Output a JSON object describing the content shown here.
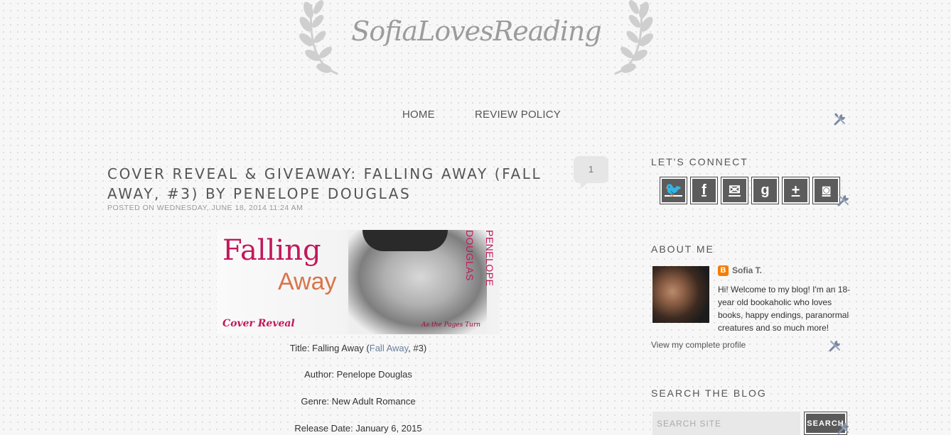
{
  "header": {
    "site_title": "SofiaLovesReading"
  },
  "nav": {
    "items": [
      {
        "label": "HOME"
      },
      {
        "label": "REVIEW POLICY"
      }
    ]
  },
  "post": {
    "title": "COVER REVEAL & GIVEAWAY: FALLING AWAY (FALL AWAY, #3) BY PENELOPE DOUGLAS",
    "meta_prefix": "POSTED ON",
    "meta_date": "WEDNESDAY, JUNE 18, 2014 11:24 AM",
    "comment_count": "1",
    "banner": {
      "line1": "Falling",
      "line2": "Away",
      "cover_text": "Cover Reveal",
      "credit": "As the Pages Turn",
      "author": "PENELOPE DOUGLAS"
    },
    "details": {
      "title_label": "Title: Falling Away (",
      "series_link": "Fall Away",
      "title_suffix": ", #3)",
      "author": "Author: Penelope Douglas",
      "genre": "Genre: New Adult Romance",
      "release": "Release Date: January 6, 2015"
    }
  },
  "sidebar": {
    "connect": {
      "title": "LET'S CONNECT",
      "icons": [
        {
          "name": "twitter",
          "glyph": "🐦"
        },
        {
          "name": "facebook",
          "glyph": "f"
        },
        {
          "name": "email",
          "glyph": "✉"
        },
        {
          "name": "goodreads",
          "glyph": "g"
        },
        {
          "name": "google-plus",
          "glyph": "+"
        },
        {
          "name": "instagram",
          "glyph": "◙"
        }
      ]
    },
    "about": {
      "title": "ABOUT ME",
      "name": "Sofia T.",
      "text": "Hi! Welcome to my blog! I'm an 18-year old bookaholic who loves books, happy endings, paranormal creatures and so much more!",
      "profile_link": "View my complete profile"
    },
    "search": {
      "title": "SEARCH THE BLOG",
      "placeholder": "SEARCH SITE",
      "button": "SEARCH"
    }
  }
}
